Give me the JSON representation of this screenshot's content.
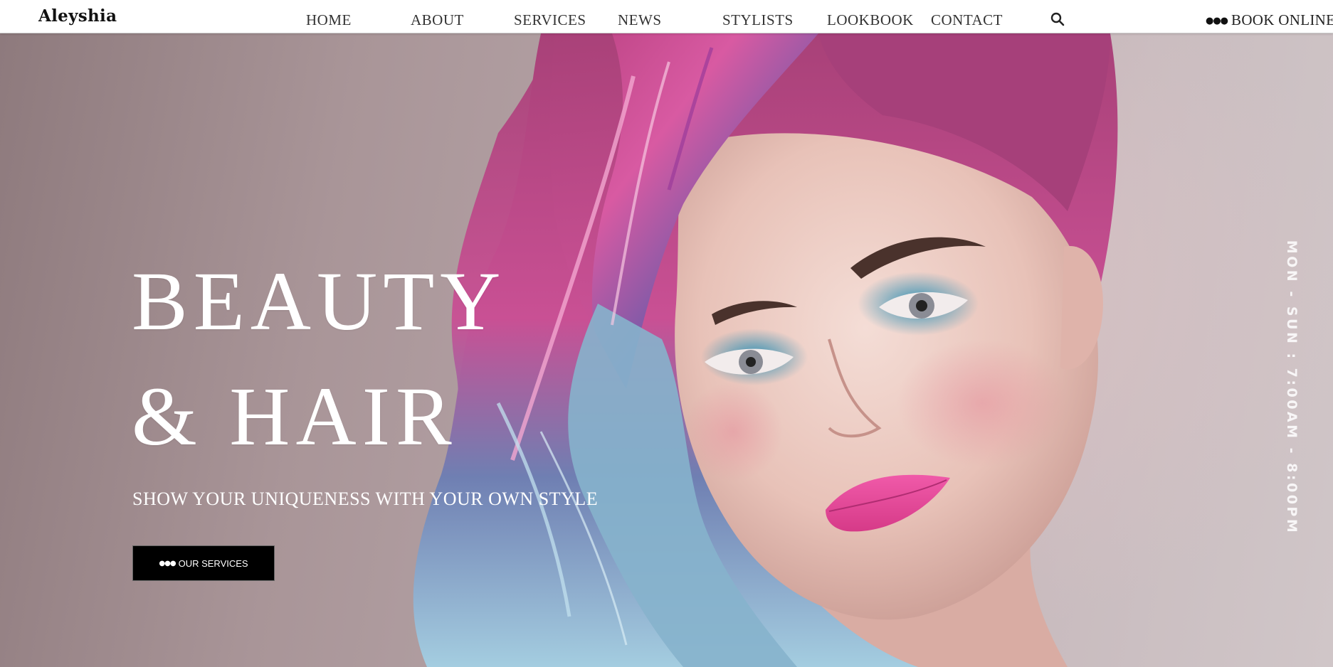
{
  "header": {
    "logo": "Aleyshia",
    "nav": [
      {
        "label": "HOME"
      },
      {
        "label": "ABOUT"
      },
      {
        "label": "SERVICES"
      },
      {
        "label": "NEWS"
      },
      {
        "label": "STYLISTS"
      },
      {
        "label": "LOOKBOOK"
      },
      {
        "label": "CONTACT"
      }
    ],
    "search_icon": "search-icon",
    "book_dots": "●●●",
    "book_label": "BOOK ONLINE"
  },
  "hero": {
    "headline_line1": "BEAUTY",
    "headline_line2": "& HAIR",
    "tagline": "SHOW YOUR UNIQUENESS WITH YOUR OWN STYLE",
    "cta_dots": "●●●",
    "cta_label": "OUR SERVICES",
    "hours": "MON - SUN : 7:00AM - 8:00PM",
    "image": "portrait of a woman with pink, purple and blue dyed hair"
  },
  "colors": {
    "header_bg": "#ffffff",
    "hero_text": "#ffffff",
    "cta_bg": "#000000",
    "hair_pink": "#c94a8f",
    "hair_blue": "#8fb6cf",
    "lip_pink": "#e9479c"
  }
}
